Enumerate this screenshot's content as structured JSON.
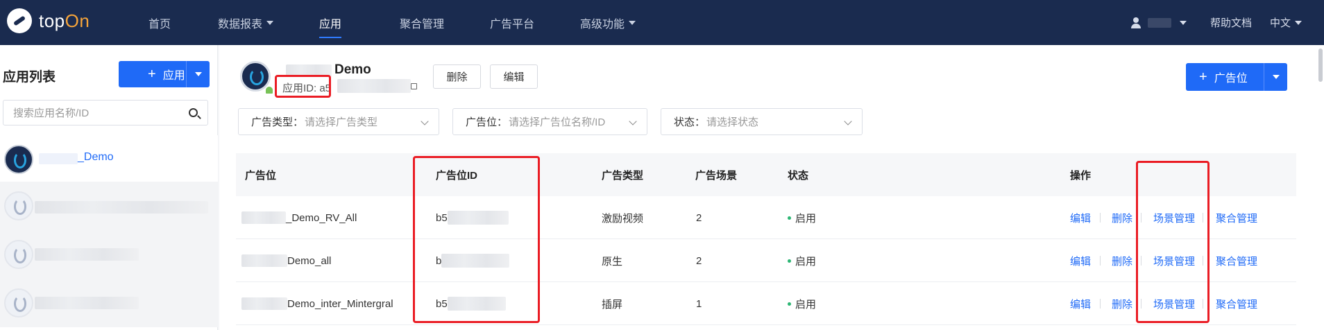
{
  "topbar": {
    "logo_text_a": "top",
    "logo_text_b": "On",
    "nav": [
      "首页",
      "数据报表",
      "应用",
      "聚合管理",
      "广告平台",
      "高级功能"
    ],
    "help": "帮助文档",
    "lang": "中文"
  },
  "sidebar": {
    "title": "应用列表",
    "add_button": "应用",
    "search_placeholder": "搜索应用名称/ID",
    "selected_app": "_Demo"
  },
  "header": {
    "app_title": "Demo",
    "app_id_label": "应用ID: a5",
    "delete": "删除",
    "edit": "编辑",
    "add_placement": "广告位"
  },
  "filters": [
    {
      "label": "广告类型：",
      "placeholder": "请选择广告类型"
    },
    {
      "label": "广告位：",
      "placeholder": "请选择广告位名称/ID"
    },
    {
      "label": "状态：",
      "placeholder": "请选择状态"
    }
  ],
  "table": {
    "headers": [
      "广告位",
      "广告位ID",
      "广告类型",
      "广告场景",
      "状态",
      "操作"
    ],
    "rows": [
      {
        "name": "_Demo_RV_All",
        "id": "b5",
        "type": "激励视频",
        "scenes": "2",
        "status": "启用"
      },
      {
        "name": "Demo_all",
        "id": "b",
        "type": "原生",
        "scenes": "2",
        "status": "启用"
      },
      {
        "name": "Demo_inter_Mintergral",
        "id": "b5",
        "type": "插屏",
        "scenes": "1",
        "status": "启用"
      }
    ],
    "actions": [
      "编辑",
      "删除",
      "场景管理",
      "聚合管理"
    ]
  },
  "colors": {
    "nav_bg": "#1a2b4f",
    "accent": "#1f6af7",
    "highlight": "#ea1c24",
    "status_on": "#2bb673"
  }
}
